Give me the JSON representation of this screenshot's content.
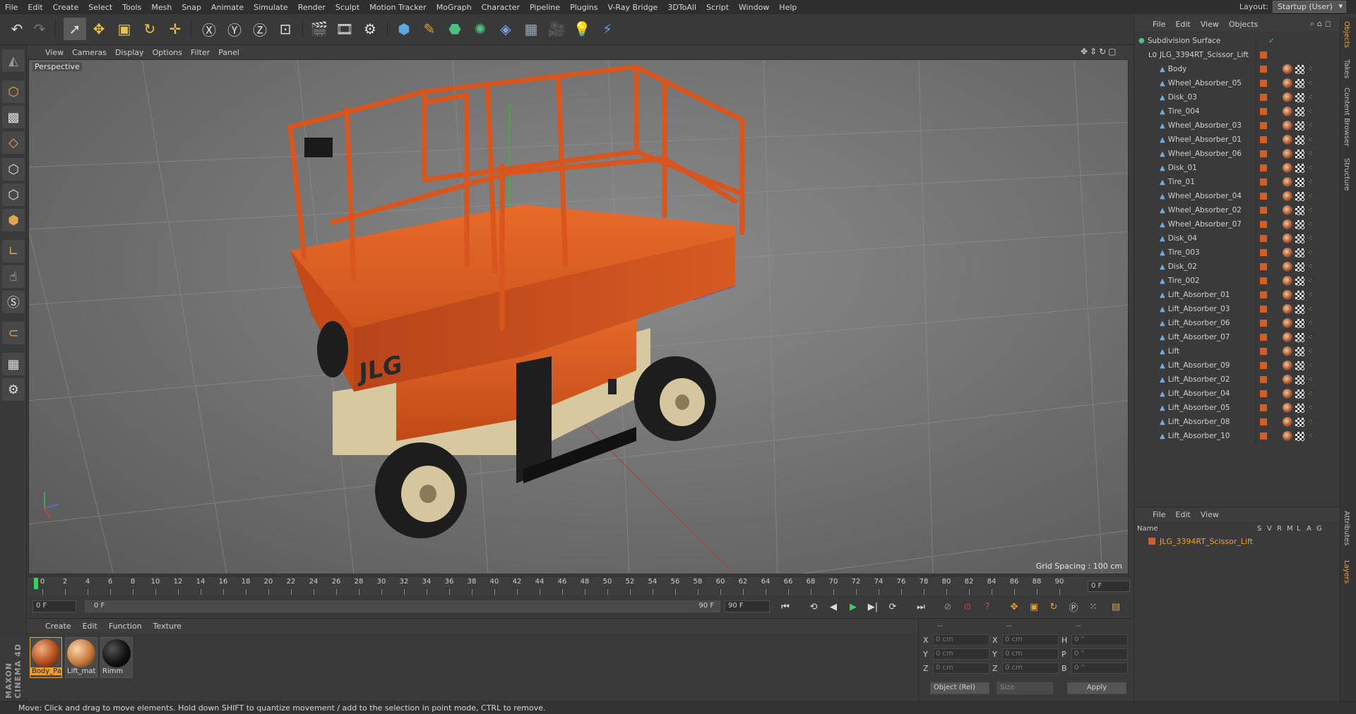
{
  "menu": [
    "File",
    "Edit",
    "Create",
    "Select",
    "Tools",
    "Mesh",
    "Snap",
    "Animate",
    "Simulate",
    "Render",
    "Sculpt",
    "Motion Tracker",
    "MoGraph",
    "Character",
    "Pipeline",
    "Plugins",
    "V-Ray Bridge",
    "3DToAll",
    "Script",
    "Window",
    "Help"
  ],
  "layout": {
    "label": "Layout:",
    "value": "Startup (User)"
  },
  "viewport": {
    "menu": [
      "View",
      "Cameras",
      "Display",
      "Options",
      "Filter",
      "Panel"
    ],
    "label": "Perspective",
    "grid_spacing": "Grid Spacing : 100 cm",
    "model_name": "JLG_3394RT_Scissor_Lift",
    "logo_text": "JLG"
  },
  "timeline": {
    "ticks": [
      "0",
      "2",
      "4",
      "6",
      "8",
      "10",
      "12",
      "14",
      "16",
      "18",
      "20",
      "22",
      "24",
      "26",
      "28",
      "30",
      "32",
      "34",
      "36",
      "38",
      "40",
      "42",
      "44",
      "46",
      "48",
      "50",
      "52",
      "54",
      "56",
      "58",
      "60",
      "62",
      "64",
      "66",
      "68",
      "70",
      "72",
      "74",
      "76",
      "78",
      "80",
      "82",
      "84",
      "86",
      "88",
      "90"
    ],
    "current_frame": "0 F",
    "start": "0 F",
    "range_start": "0 F",
    "range_end": "90 F",
    "end": "90 F"
  },
  "materials": {
    "menu": [
      "Create",
      "Edit",
      "Function",
      "Texture"
    ],
    "items": [
      {
        "name": "Body_Pa",
        "color": "#c05a2a"
      },
      {
        "name": "Lift_mat",
        "color": "#c8783a"
      },
      {
        "name": "Rimm",
        "color": "#111111"
      }
    ]
  },
  "coordinates": {
    "header": [
      "--",
      "--",
      "--"
    ],
    "rows": [
      {
        "a": "X",
        "av": "0 cm",
        "b": "X",
        "bv": "0 cm",
        "c": "H",
        "cv": "0 °"
      },
      {
        "a": "Y",
        "av": "0 cm",
        "b": "Y",
        "bv": "0 cm",
        "c": "P",
        "cv": "0 °"
      },
      {
        "a": "Z",
        "av": "0 cm",
        "b": "Z",
        "bv": "0 cm",
        "c": "B",
        "cv": "0 °"
      }
    ],
    "mode": "Object (Rel)",
    "size_mode": "Size",
    "apply": "Apply"
  },
  "objects": {
    "menu": [
      "File",
      "Edit",
      "View",
      "Objects"
    ],
    "root": "Subdivision Surface",
    "group": "JLG_3394RT_Scissor_Lift",
    "items": [
      "Body",
      "Wheel_Absorber_05",
      "Disk_03",
      "Tire_004",
      "Wheel_Absorber_03",
      "Wheel_Absorber_01",
      "Wheel_Absorber_06",
      "Disk_01",
      "Tire_01",
      "Wheel_Absorber_04",
      "Wheel_Absorber_02",
      "Wheel_Absorber_07",
      "Disk_04",
      "Tire_003",
      "Disk_02",
      "Tire_002",
      "Lift_Absorber_01",
      "Lift_Absorber_03",
      "Lift_Absorber_06",
      "Lift_Absorber_07",
      "Lift",
      "Lift_Absorber_09",
      "Lift_Absorber_02",
      "Lift_Absorber_04",
      "Lift_Absorber_05",
      "Lift_Absorber_08",
      "Lift_Absorber_10"
    ]
  },
  "layers": {
    "menu": [
      "File",
      "Edit",
      "View"
    ],
    "columns": [
      "Name",
      "S",
      "V",
      "R",
      "M",
      "L",
      "A",
      "G"
    ],
    "row": "JLG_3394RT_Scissor_Lift"
  },
  "right_tabs": [
    "Objects",
    "Takes",
    "Content Browser",
    "Structure",
    "Attributes",
    "Layers"
  ],
  "status": "Move: Click and drag to move elements. Hold down SHIFT to quantize movement / add to the selection in point mode, CTRL to remove.",
  "brand": "MAXON CINEMA 4D",
  "colors": {
    "accent": "#e8c24a",
    "lift_orange": "#d8561e",
    "selection": "#f0a030"
  }
}
